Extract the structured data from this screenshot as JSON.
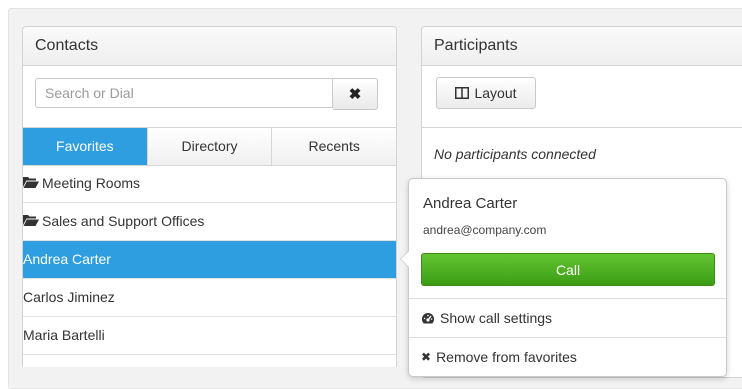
{
  "contacts": {
    "title": "Contacts",
    "search_placeholder": "Search or Dial",
    "clear_icon": "close-icon",
    "tabs": [
      {
        "label": "Favorites",
        "active": true
      },
      {
        "label": "Directory",
        "active": false
      },
      {
        "label": "Recents",
        "active": false
      }
    ],
    "items": [
      {
        "label": "Meeting Rooms",
        "icon": "folder-open-icon"
      },
      {
        "label": "Sales and Support Offices",
        "icon": "folder-open-icon"
      },
      {
        "label": "Andrea Carter",
        "selected": true
      },
      {
        "label": "Carlos Jiminez"
      },
      {
        "label": "Maria Bartelli"
      }
    ]
  },
  "participants": {
    "title": "Participants",
    "layout_label": "Layout",
    "layout_icon": "columns-icon",
    "empty_text": "No participants connected"
  },
  "popover": {
    "name": "Andrea Carter",
    "email": "andrea@company.com",
    "call_label": "Call",
    "show_settings_label": "Show call settings",
    "show_settings_icon": "dashboard-icon",
    "remove_label": "Remove from favorites",
    "remove_icon": "close-icon"
  },
  "colors": {
    "accent": "#2f9ee0",
    "call_green": "#4caf22"
  }
}
